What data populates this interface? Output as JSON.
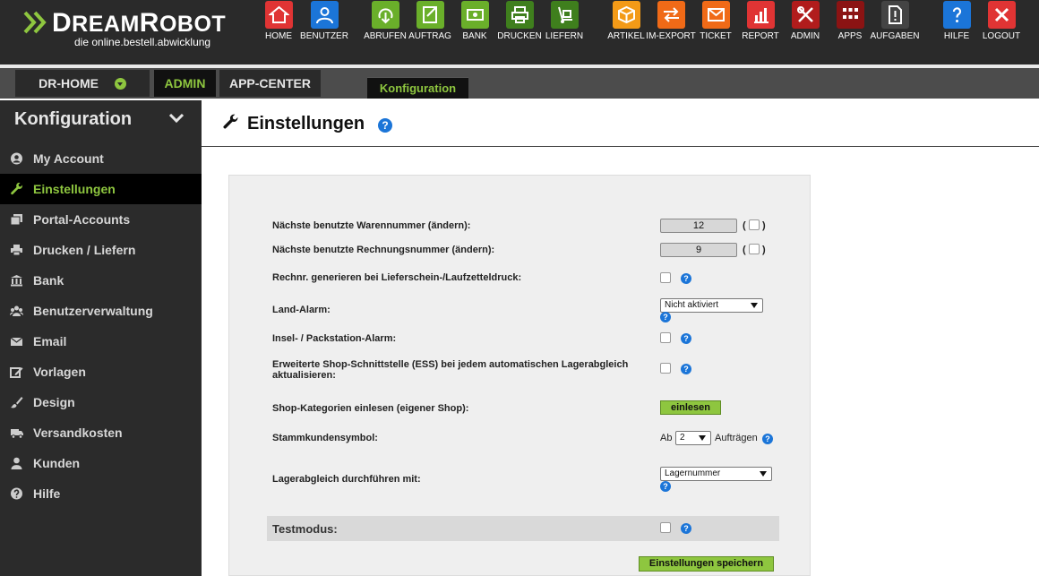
{
  "app": {
    "brand": "DreamRobot",
    "tagline": "die online.bestell.abwicklung"
  },
  "topnav": [
    {
      "label": "HOME",
      "icon": "home-icon",
      "color": "#e03434"
    },
    {
      "label": "BENUTZER",
      "icon": "user-icon",
      "color": "#1b75d8"
    },
    {
      "label": "ABRUFEN",
      "icon": "download-icon",
      "color": "#6aaf2a"
    },
    {
      "label": "AUFTRAG",
      "icon": "order-icon",
      "color": "#6aaf2a"
    },
    {
      "label": "BANK",
      "icon": "bank-icon",
      "color": "#6aaf2a"
    },
    {
      "label": "DRUCKEN",
      "icon": "printer-icon",
      "color": "#3f7f1d"
    },
    {
      "label": "LIEFERN",
      "icon": "hand-truck-icon",
      "color": "#3f7f1d"
    },
    {
      "label": "ARTIKEL",
      "icon": "box-icon",
      "color": "#f39a17"
    },
    {
      "label": "IM-EXPORT",
      "icon": "import-export-icon",
      "color": "#f06a17"
    },
    {
      "label": "TICKET",
      "icon": "envelope-icon",
      "color": "#f06a17"
    },
    {
      "label": "REPORT",
      "icon": "report-icon",
      "color": "#e03434"
    },
    {
      "label": "ADMIN",
      "icon": "tools-icon",
      "color": "#b11c1c"
    },
    {
      "label": "APPS",
      "icon": "apps-grid-icon",
      "color": "#8b1313"
    },
    {
      "label": "AUFGABEN",
      "icon": "task-icon",
      "color": "#444444"
    },
    {
      "label": "HILFE",
      "icon": "help-icon",
      "color": "#1b75d8"
    },
    {
      "label": "LOGOUT",
      "icon": "logout-icon",
      "color": "#e03434"
    }
  ],
  "tabs": [
    {
      "label": "DR-HOME"
    },
    {
      "label": "ADMIN"
    },
    {
      "label": "APP-CENTER"
    }
  ],
  "subtab": "Konfiguration",
  "sidebar": {
    "title": "Konfiguration",
    "items": [
      {
        "label": "My Account",
        "icon": "account-icon"
      },
      {
        "label": "Einstellungen",
        "icon": "wrench-icon"
      },
      {
        "label": "Portal-Accounts",
        "icon": "copy-icon"
      },
      {
        "label": "Drucken / Liefern",
        "icon": "printer-icon"
      },
      {
        "label": "Bank",
        "icon": "bank-icon"
      },
      {
        "label": "Benutzerverwaltung",
        "icon": "users-icon"
      },
      {
        "label": "Email",
        "icon": "envelope-icon"
      },
      {
        "label": "Vorlagen",
        "icon": "edit-icon"
      },
      {
        "label": "Design",
        "icon": "brush-icon"
      },
      {
        "label": "Versandkosten",
        "icon": "truck-icon"
      },
      {
        "label": "Kunden",
        "icon": "user-icon"
      },
      {
        "label": "Hilfe",
        "icon": "help-icon"
      }
    ]
  },
  "page": {
    "title": "Einstellungen"
  },
  "form": {
    "warennummer": {
      "label": "Nächste benutzte Warennummer   (ändern):",
      "value": "12"
    },
    "rechnungsnummer": {
      "label": "Nächste benutzte Rechnungsnummer   (ändern):",
      "value": "9"
    },
    "paren_open": "(",
    "paren_close": ")",
    "rechnr_generieren": {
      "label": "Rechnr. generieren bei Lieferschein-/Laufzetteldruck:"
    },
    "land_alarm": {
      "label": "Land-Alarm:",
      "selected": "Nicht aktiviert"
    },
    "insel_alarm": {
      "label": "Insel- / Packstation-Alarm:"
    },
    "ess": {
      "label": "Erweiterte Shop-Schnittstelle (ESS) bei jedem automatischen Lagerabgleich aktualisieren:"
    },
    "kategorien": {
      "label": "Shop-Kategorien einlesen (eigener Shop):",
      "button": "einlesen"
    },
    "stammkunden": {
      "label": "Stammkundensymbol:",
      "prefix": "Ab",
      "selected": "2",
      "suffix": "Aufträgen"
    },
    "lagerabgleich": {
      "label": "Lagerabgleich durchführen mit:",
      "selected": "Lagernummer"
    },
    "testmodus": {
      "label": "Testmodus:"
    },
    "save_button": "Einstellungen speichern"
  },
  "help_glyph": "?"
}
